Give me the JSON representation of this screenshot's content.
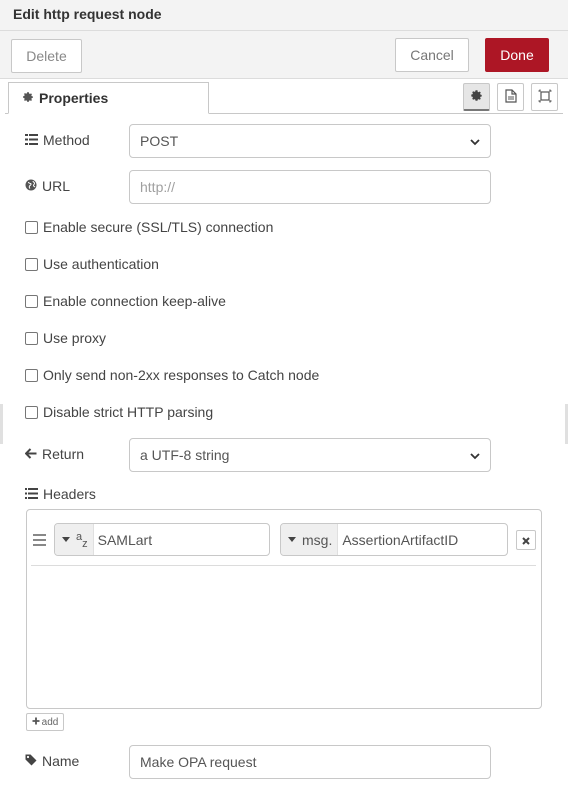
{
  "dialog": {
    "title": "Edit http request node",
    "delete_label": "Delete",
    "cancel_label": "Cancel",
    "done_label": "Done",
    "accent_color": "#ad1625"
  },
  "tabs": {
    "active_label": "Properties",
    "icons": [
      "gear-icon",
      "description-icon",
      "appearance-icon"
    ]
  },
  "form": {
    "method": {
      "label": "Method",
      "value": "POST",
      "icon": "list-icon"
    },
    "url": {
      "label": "URL",
      "value": "",
      "placeholder": "http://",
      "icon": "globe-icon"
    },
    "checkboxes": [
      {
        "label": "Enable secure (SSL/TLS) connection",
        "checked": false
      },
      {
        "label": "Use authentication",
        "checked": false
      },
      {
        "label": "Enable connection keep-alive",
        "checked": false
      },
      {
        "label": "Use proxy",
        "checked": false
      },
      {
        "label": "Only send non-2xx responses to Catch node",
        "checked": false
      },
      {
        "label": "Disable strict HTTP parsing",
        "checked": false
      }
    ],
    "return": {
      "label": "Return",
      "value": "a UTF-8 string",
      "icon": "arrow-left-icon"
    },
    "headers": {
      "label": "Headers",
      "rows": [
        {
          "key_type": "a z",
          "key_value": "SAMLart",
          "value_type": "msg.",
          "value_value": "AssertionArtifactID"
        }
      ],
      "add_label": "add"
    },
    "name": {
      "label": "Name",
      "value": "Make OPA request",
      "icon": "tag-icon"
    }
  }
}
